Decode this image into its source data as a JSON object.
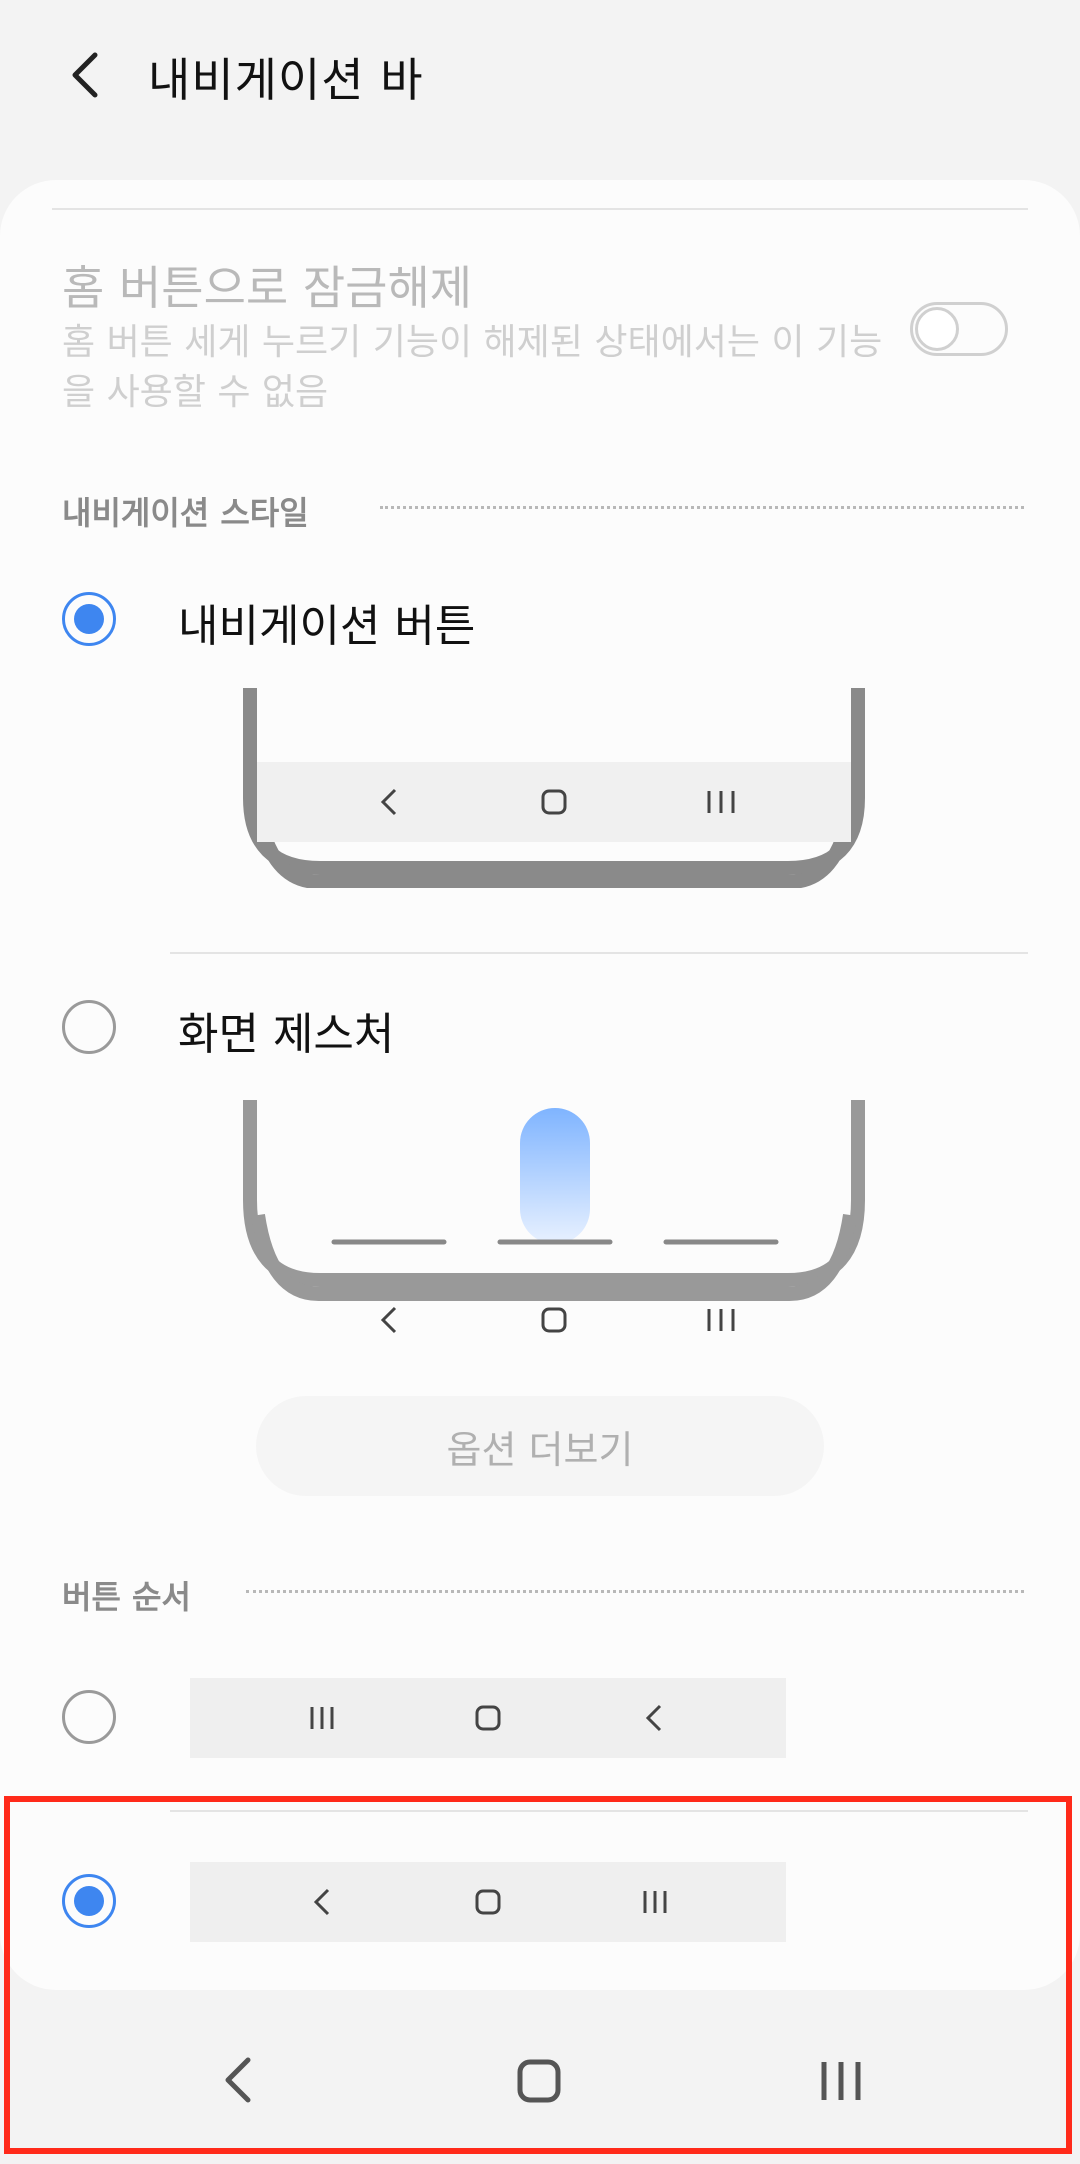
{
  "header": {
    "title": "내비게이션 바",
    "back_icon": "chevron-left-icon"
  },
  "unlock": {
    "title": "홈 버튼으로 잠금해제",
    "description": "홈 버튼 세게 누르기 기능이 해제된 상태에서는 이 기능을 사용할 수 없음",
    "toggle_on": false
  },
  "nav_style": {
    "header": "내비게이션 스타일",
    "options": [
      {
        "label": "내비게이션 버튼",
        "selected": true
      },
      {
        "label": "화면 제스처",
        "selected": false
      }
    ],
    "more_options_label": "옵션 더보기"
  },
  "button_order": {
    "header": "버튼 순서",
    "options": [
      {
        "order": [
          "recents-icon",
          "home-icon",
          "back-icon"
        ],
        "selected": false
      },
      {
        "order": [
          "back-icon",
          "home-icon",
          "recents-icon"
        ],
        "selected": true
      }
    ]
  },
  "system_nav": {
    "icons": [
      "back-icon",
      "home-icon",
      "recents-icon"
    ]
  },
  "colors": {
    "accent": "#3e86f0",
    "highlight": "#ff2a1a",
    "disabled_text": "#b9b9b9"
  }
}
